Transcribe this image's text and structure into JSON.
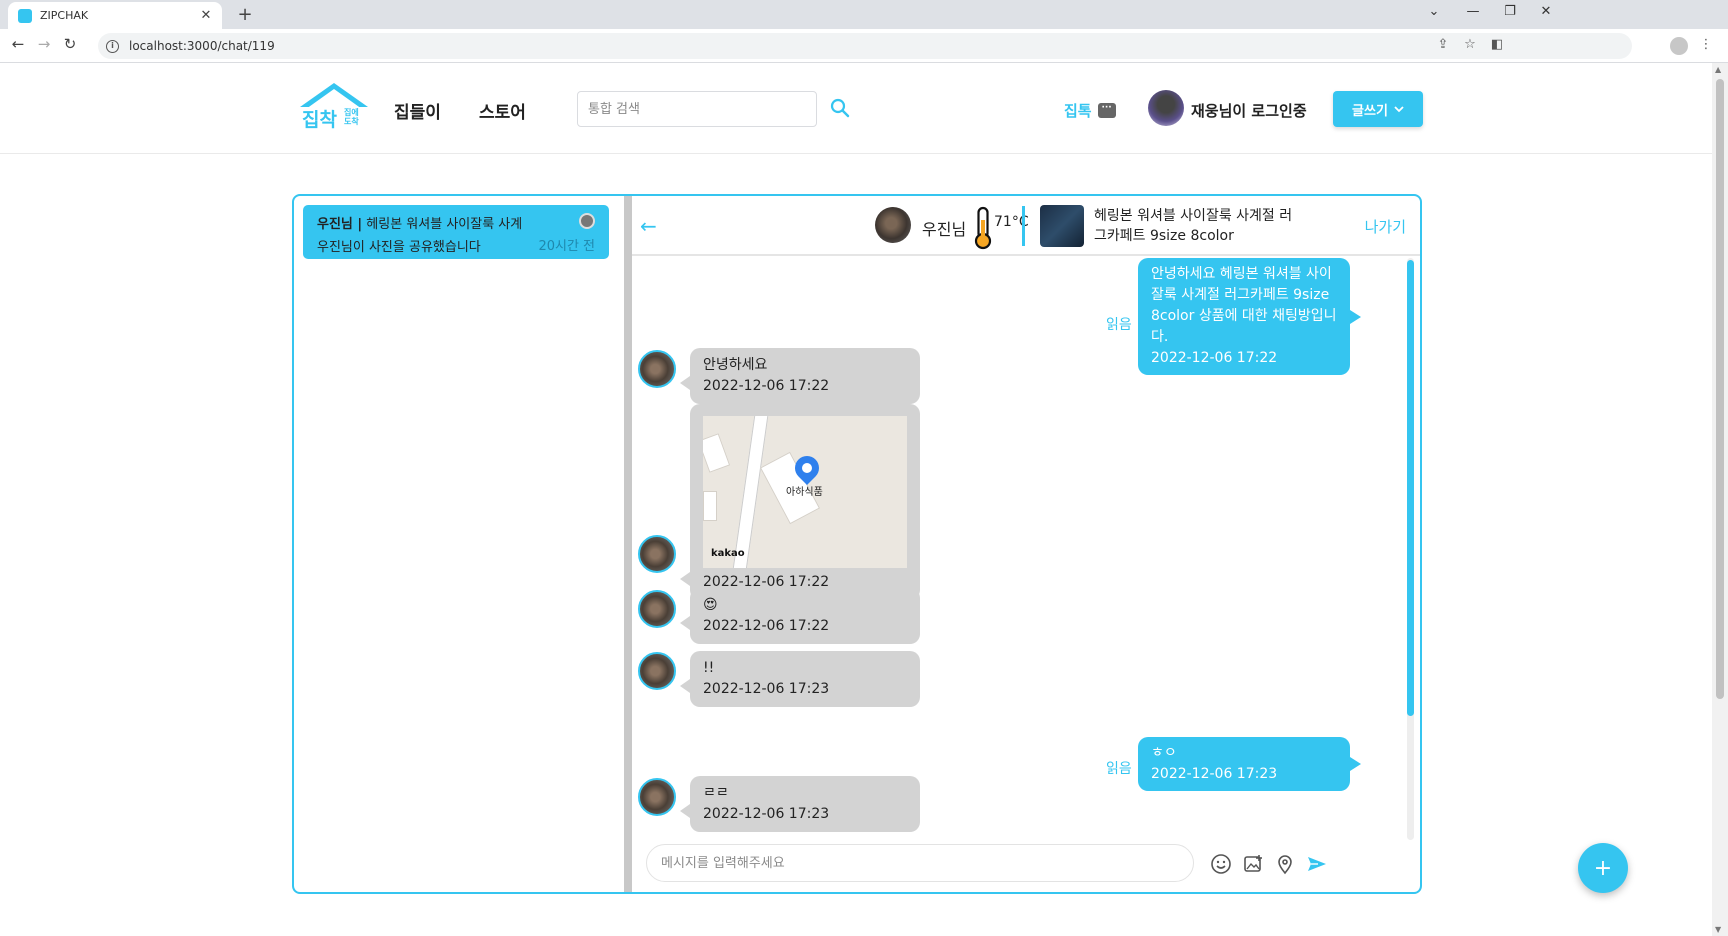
{
  "browser": {
    "tab_title": "ZIPCHAK",
    "tab_close": "✕",
    "new_tab": "+",
    "url": "localhost:3000/chat/119",
    "info_icon": "i"
  },
  "header": {
    "logo_main": "집착",
    "logo_sub": "집에 도착",
    "nav": [
      "집들이",
      "스토어"
    ],
    "search_placeholder": "통합 검색",
    "jiptok_label": "집톡",
    "jiptok_icon_glyph": "···",
    "user_label": "재웅님이 로그인중",
    "write_label": "글쓰기"
  },
  "room_list": [
    {
      "name": "우진님 |",
      "product": "헤링본 워셔블 사이잘룩 사계",
      "preview": "우진님이 사진을 공유했습니다",
      "time": "20시간 전"
    }
  ],
  "chat_header": {
    "partner_name": "우진님",
    "temperature": "71°C",
    "product_title": "헤링본 워셔블 사이잘룩 사계절 러그카페트 9size 8color",
    "leave_label": "나가기"
  },
  "messages": {
    "m1": {
      "text": "안녕하세요 헤링본 워셔블 사이잘룩 사계절 러그카페트 9size 8color 상품에 대한 채팅방입니다.",
      "time": "2022-12-06 17:22",
      "read": "읽음"
    },
    "m2": {
      "text": "안녕하세요",
      "time": "2022-12-06 17:22"
    },
    "m3": {
      "place": "아하식품",
      "brand": "kakao",
      "time": "2022-12-06 17:22"
    },
    "m4": {
      "text": "😍",
      "time": "2022-12-06 17:22"
    },
    "m5": {
      "text": "!!",
      "time": "2022-12-06 17:23"
    },
    "m6": {
      "text": "ㅎㅇ",
      "time": "2022-12-06 17:23",
      "read": "읽음"
    },
    "m7": {
      "text": "ㄹㄹ",
      "time": "2022-12-06 17:23"
    }
  },
  "input": {
    "placeholder": "메시지를 입력해주세요"
  },
  "fab_label": "+",
  "colors": {
    "accent": "#35c5f0",
    "incoming_bubble": "#d3d3d3"
  }
}
